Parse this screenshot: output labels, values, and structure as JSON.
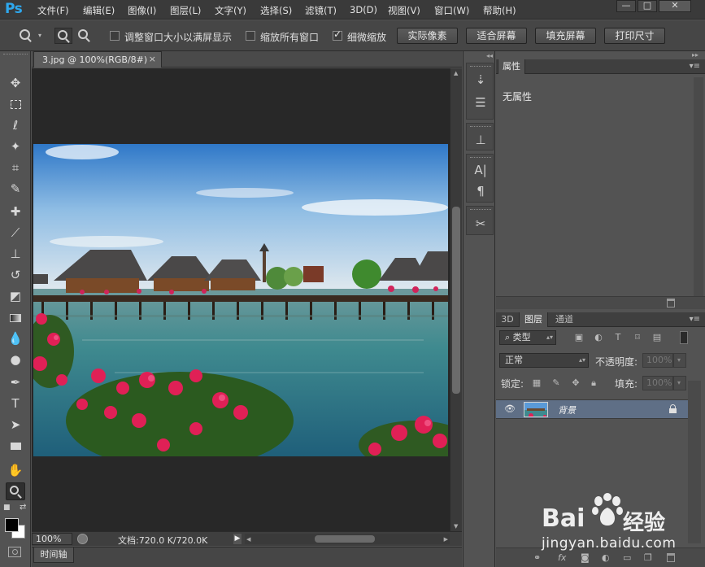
{
  "app": {
    "logo": "Ps"
  },
  "menu": [
    "文件(F)",
    "编辑(E)",
    "图像(I)",
    "图层(L)",
    "文字(Y)",
    "选择(S)",
    "滤镜(T)",
    "3D(D)",
    "视图(V)",
    "窗口(W)",
    "帮助(H)"
  ],
  "window_controls": {
    "minimize": "—",
    "maximize": "□",
    "close": "✕"
  },
  "options": {
    "resize_windows_label": "调整窗口大小以满屏显示",
    "zoom_all_label": "缩放所有窗口",
    "scrubby_zoom_label": "细微缩放",
    "btn_actual_pixels": "实际像素",
    "btn_fit_screen": "适合屏幕",
    "btn_fill_screen": "填充屏幕",
    "btn_print_size": "打印尺寸",
    "resize_windows_checked": false,
    "zoom_all_checked": false,
    "scrubby_zoom_checked": true
  },
  "document": {
    "tab_label": "3.jpg @ 100%(RGB/8#)",
    "tab_close": "×"
  },
  "status": {
    "zoom": "100%",
    "doc_info": "文档:720.0 K/720.0K",
    "arrow": "▶"
  },
  "timeline_tab": "时间轴",
  "properties_panel": {
    "tab": "属性",
    "empty_text": "无属性",
    "menu": "▾≡"
  },
  "layers_panel": {
    "tabs": [
      "3D",
      "图层",
      "通道"
    ],
    "filter_kind": "类型",
    "blend_mode": "正常",
    "opacity_label": "不透明度:",
    "opacity_value": "100%",
    "lock_label": "锁定:",
    "fill_label": "填充:",
    "fill_value": "100%",
    "layer_name": "背景",
    "eye": "👁"
  },
  "watermark": {
    "brand_left": "Bai",
    "brand_right": "经验",
    "url": "jingyan.baidu.com"
  },
  "colors": {
    "accent_logo": "#2ea8ee",
    "selected_layer": "#5f6f86",
    "foreground": "#000000",
    "background": "#ffffff"
  }
}
